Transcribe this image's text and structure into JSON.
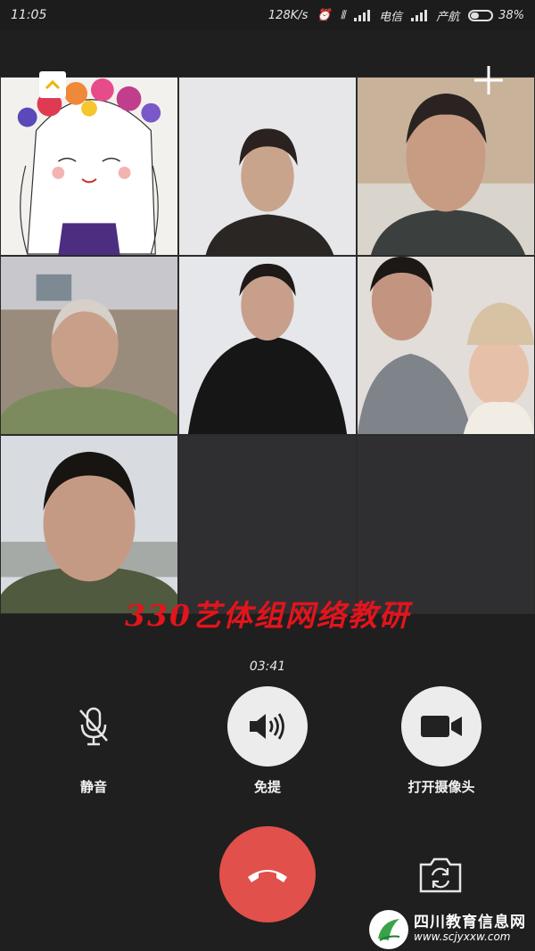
{
  "status_bar": {
    "time": "11:05",
    "speed": "128K/s",
    "carrier_1": "电信",
    "carrier_2": "产航",
    "battery": "38%"
  },
  "grid": {
    "participants": [
      {
        "id": "p1",
        "kind": "drawing"
      },
      {
        "id": "p2",
        "kind": "video"
      },
      {
        "id": "p3",
        "kind": "video"
      },
      {
        "id": "p4",
        "kind": "video"
      },
      {
        "id": "p5",
        "kind": "video"
      },
      {
        "id": "p6",
        "kind": "video"
      },
      {
        "id": "p7",
        "kind": "video"
      }
    ],
    "empty_slots": 2
  },
  "overlay": {
    "title": "330艺体组网络教研"
  },
  "call": {
    "timer": "03:41",
    "mute_label": "静音",
    "speaker_label": "免提",
    "camera_label": "打开摄像头"
  },
  "watermark": {
    "title": "四川教育信息网",
    "url": "www.scjyxxw.com"
  },
  "icons": {
    "collapse": "chevron-up-icon",
    "add": "plus-icon",
    "mute": "mic-off-icon",
    "speaker": "speaker-icon",
    "camera": "video-camera-icon",
    "hangup": "phone-hangup-icon",
    "switch_camera": "camera-switch-icon"
  },
  "colors": {
    "hangup": "#e2504b",
    "overlay_text": "#e3141c",
    "background": "#1f1f1f"
  }
}
